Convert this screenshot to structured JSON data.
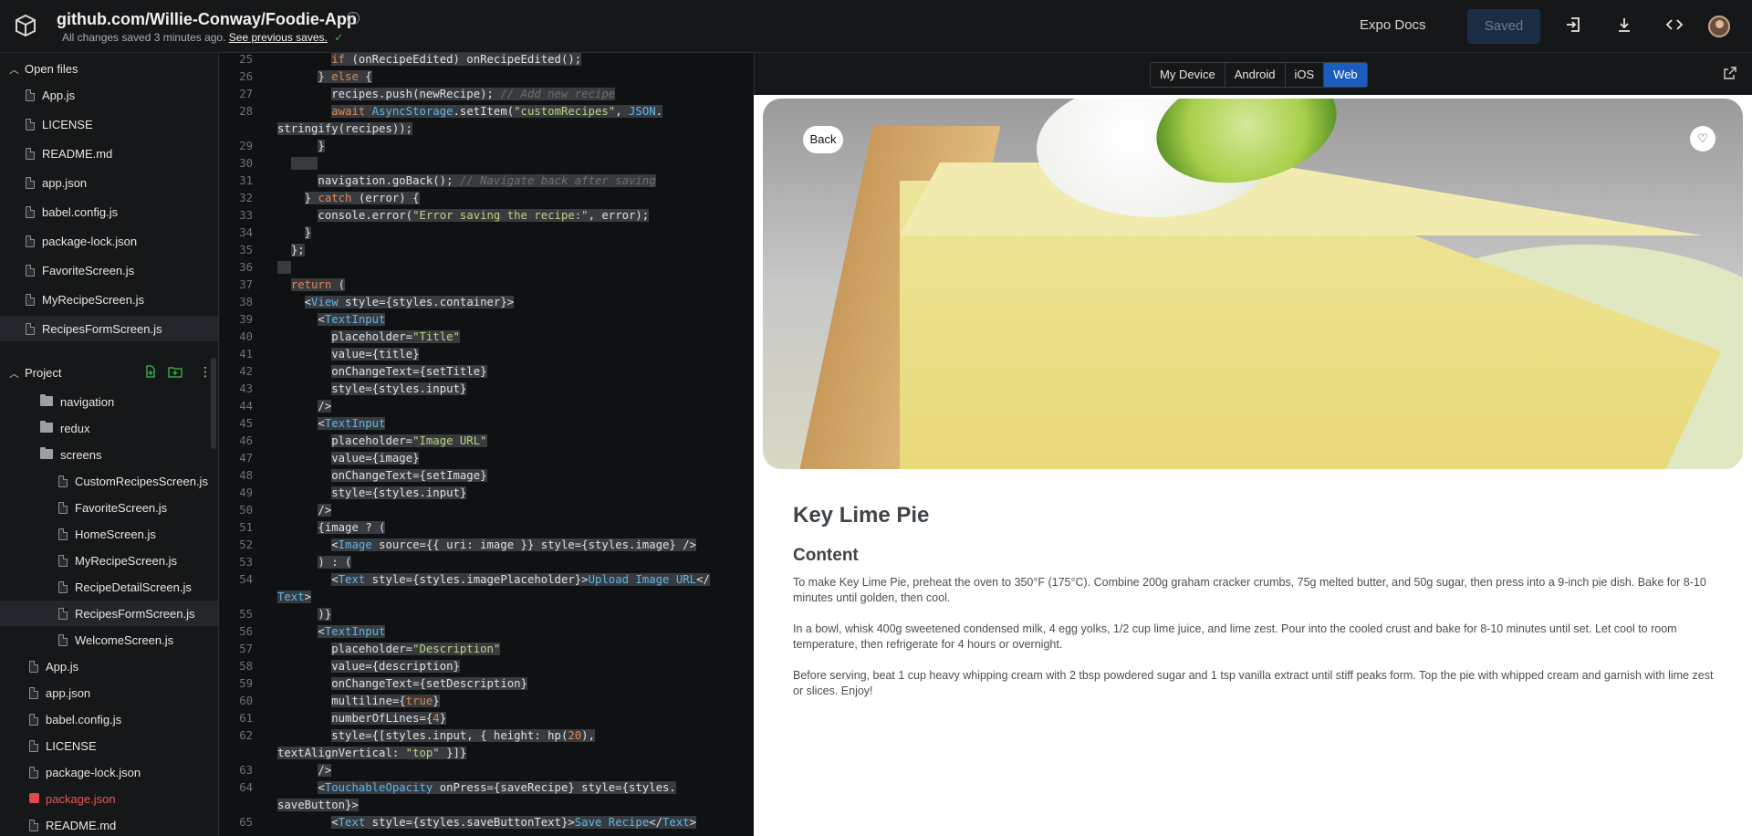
{
  "header": {
    "title": "github.com/Willie-Conway/Foodie-App",
    "info": "i",
    "subtitle": "All changes saved 3 minutes ago.",
    "subtitle_link": "See previous saves.",
    "check": "✓",
    "expo_docs": "Expo Docs",
    "saved": "Saved",
    "icons": [
      "login-icon",
      "download-icon",
      "code-icon"
    ]
  },
  "open_files": {
    "label": "Open files",
    "items": [
      "App.js",
      "LICENSE",
      "README.md",
      "app.json",
      "babel.config.js",
      "package-lock.json",
      "FavoriteScreen.js",
      "MyRecipeScreen.js",
      "RecipesFormScreen.js"
    ]
  },
  "project": {
    "label": "Project",
    "folders": [
      "navigation",
      "redux",
      "screens"
    ],
    "screens": [
      "CustomRecipesScreen.js",
      "FavoriteScreen.js",
      "HomeScreen.js",
      "MyRecipeScreen.js",
      "RecipeDetailScreen.js",
      "RecipesFormScreen.js",
      "WelcomeScreen.js"
    ],
    "root_files": [
      "App.js",
      "app.json",
      "babel.config.js",
      "LICENSE",
      "package-lock.json",
      "package.json",
      "README.md"
    ]
  },
  "preview": {
    "tabs": [
      "My Device",
      "Android",
      "iOS",
      "Web"
    ],
    "selected_tab": "Web",
    "back": "Back",
    "heart": "♡",
    "title": "Key Lime Pie",
    "content_heading": "Content",
    "paragraphs": [
      "To make Key Lime Pie, preheat the oven to 350°F (175°C). Combine 200g graham cracker crumbs, 75g melted butter, and 50g sugar, then press into a 9-inch pie dish. Bake for 8-10 minutes until golden, then cool.",
      "In a bowl, whisk 400g sweetened condensed milk, 4 egg yolks, 1/2 cup lime juice, and lime zest. Pour into the cooled crust and bake for 8-10 minutes until set. Let cool to room temperature, then refrigerate for 4 hours or overnight.",
      "Before serving, beat 1 cup heavy whipping cream with 2 tbsp powdered sugar and 1 tsp vanilla extract until stiff peaks form. Top the pie with whipped cream and garnish with lime zest or slices. Enjoy!"
    ]
  },
  "code_lines": [
    {
      "n": "25",
      "html": "        <span class='hl'><span class='kw'>if</span> (onRecipeEdited) onRecipeEdited();</span>"
    },
    {
      "n": "26",
      "html": "      <span class='hl'>} <span class='kw'>else</span> {</span>"
    },
    {
      "n": "27",
      "html": "        <span class='hl'>recipes.push(newRecipe); <span class='cmt'>// Add new recipe</span></span>"
    },
    {
      "n": "28",
      "html": "        <span class='hl'><span class='kw'>await</span> <span class='tag'>AsyncStorage</span>.setItem(<span class='str'>\"customRecipes\"</span>, <span class='tag'>JSON</span>.</span>"
    },
    {
      "n": "",
      "html": "<span class='hl'>stringify(recipes));</span>"
    },
    {
      "n": "29",
      "html": "      <span class='hl'>}</span>"
    },
    {
      "n": "30",
      "html": "  <span class='hl'>    </span>"
    },
    {
      "n": "31",
      "html": "      <span class='hl'>navigation.goBack(); <span class='cmt'>// Navigate back after saving</span></span>"
    },
    {
      "n": "32",
      "html": "    <span class='hl'>} <span class='kw'>catch</span> (error) {</span>"
    },
    {
      "n": "33",
      "html": "      <span class='hl'>console.error(<span class='str'>\"Error saving the recipe:\"</span>, error);</span>"
    },
    {
      "n": "34",
      "html": "    <span class='hl'>}</span>"
    },
    {
      "n": "35",
      "html": "  <span class='hl'>};</span>"
    },
    {
      "n": "36",
      "html": "<span class='hl'>  </span>"
    },
    {
      "n": "37",
      "html": "  <span class='hl'><span class='kw'>return</span> (</span>"
    },
    {
      "n": "38",
      "html": "    <span class='hl'>&lt;<span class='tag'>View</span> style={styles.container}&gt;</span>"
    },
    {
      "n": "39",
      "html": "      <span class='hl'>&lt;<span class='tag'>TextInput</span></span>"
    },
    {
      "n": "40",
      "html": "        <span class='hl'>placeholder=<span class='str'>\"Title\"</span></span>"
    },
    {
      "n": "41",
      "html": "        <span class='hl'>value={title}</span>"
    },
    {
      "n": "42",
      "html": "        <span class='hl'>onChangeText={setTitle}</span>"
    },
    {
      "n": "43",
      "html": "        <span class='hl'>style={styles.input}</span>"
    },
    {
      "n": "44",
      "html": "      <span class='hl'>/&gt;</span>"
    },
    {
      "n": "45",
      "html": "      <span class='hl'>&lt;<span class='tag'>TextInput</span></span>"
    },
    {
      "n": "46",
      "html": "        <span class='hl'>placeholder=<span class='str'>\"Image URL\"</span></span>"
    },
    {
      "n": "47",
      "html": "        <span class='hl'>value={image}</span>"
    },
    {
      "n": "48",
      "html": "        <span class='hl'>onChangeText={setImage}</span>"
    },
    {
      "n": "49",
      "html": "        <span class='hl'>style={styles.input}</span>"
    },
    {
      "n": "50",
      "html": "      <span class='hl'>/&gt;</span>"
    },
    {
      "n": "51",
      "html": "      <span class='hl'>{image ? (</span>"
    },
    {
      "n": "52",
      "html": "        <span class='hl'>&lt;<span class='tag'>Image</span> source={{ uri: image }} style={styles.image} /&gt;</span>"
    },
    {
      "n": "53",
      "html": "      <span class='hl'>) : (</span>"
    },
    {
      "n": "54",
      "html": "        <span class='hl'>&lt;<span class='tag'>Text</span> style={styles.imagePlaceholder}&gt;<span class='tag'>Upload Image URL</span>&lt;/</span>"
    },
    {
      "n": "",
      "html": "<span class='hl'><span class='tag'>Text</span>&gt;</span>"
    },
    {
      "n": "55",
      "html": "      <span class='hl'>)}</span>"
    },
    {
      "n": "56",
      "html": "      <span class='hl'>&lt;<span class='tag'>TextInput</span></span>"
    },
    {
      "n": "57",
      "html": "        <span class='hl'>placeholder=<span class='str'>\"Description\"</span></span>"
    },
    {
      "n": "58",
      "html": "        <span class='hl'>value={description}</span>"
    },
    {
      "n": "59",
      "html": "        <span class='hl'>onChangeText={setDescription}</span>"
    },
    {
      "n": "60",
      "html": "        <span class='hl'>multiline={<span class='num'>true</span>}</span>"
    },
    {
      "n": "61",
      "html": "        <span class='hl'>numberOfLines={<span class='num'>4</span>}</span>"
    },
    {
      "n": "62",
      "html": "        <span class='hl'>style={[styles.input, { height: hp(<span class='num'>20</span>),</span>"
    },
    {
      "n": "",
      "html": "<span class='hl'>textAlignVertical: <span class='str'>\"top\"</span> }]}</span>"
    },
    {
      "n": "63",
      "html": "      <span class='hl'>/&gt;</span>"
    },
    {
      "n": "64",
      "html": "      <span class='hl'>&lt;<span class='tag'>TouchableOpacity</span> onPress={saveRecipe} style={styles.</span>"
    },
    {
      "n": "",
      "html": "<span class='hl'>saveButton}&gt;</span>"
    },
    {
      "n": "65",
      "html": "        <span class='hl'>&lt;<span class='tag'>Text</span> style={styles.saveButtonText}&gt;<span class='tag'>Save Recipe</span>&lt;/<span class='tag'>Text</span>&gt;</span>"
    }
  ]
}
